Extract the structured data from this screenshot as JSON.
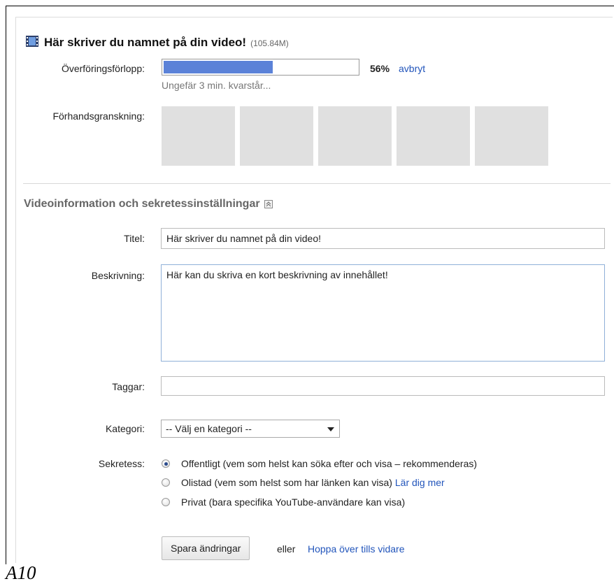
{
  "upload": {
    "video_title": "Här skriver du namnet på din video!",
    "file_size": "(105.84M)",
    "progress_label": "Överföringsförlopp:",
    "progress_percent": 56,
    "progress_text": "56%",
    "cancel_label": "avbryt",
    "time_remaining": "Ungefär 3 min. kvarstår...",
    "preview_label": "Förhandsgranskning:",
    "preview_thumbnails": 5
  },
  "section": {
    "title": "Videoinformation och sekretessinställningar"
  },
  "form": {
    "title_label": "Titel:",
    "title_value": "Här skriver du namnet på din video!",
    "description_label": "Beskrivning:",
    "description_value": "Här kan du skriva en kort beskrivning av innehållet!",
    "tags_label": "Taggar:",
    "tags_value": "",
    "category_label": "Kategori:",
    "category_value": "-- Välj en kategori --",
    "privacy_label": "Sekretess:",
    "privacy_options": [
      {
        "label": "Offentligt (vem som helst kan söka efter och visa – rekommenderas)",
        "checked": true
      },
      {
        "label": "Olistad (vem som helst som har länken kan visa)",
        "link": "Lär dig mer",
        "checked": false
      },
      {
        "label": "Privat (bara specifika YouTube-användare kan visa)",
        "checked": false
      }
    ]
  },
  "actions": {
    "save_label": "Spara ändringar",
    "or_label": "eller",
    "skip_label": "Hoppa över tills vidare"
  },
  "caption": "A10",
  "colors": {
    "progress_fill": "#5b82d8",
    "link": "#2255bb",
    "thumbnail": "#e0e0e0"
  }
}
